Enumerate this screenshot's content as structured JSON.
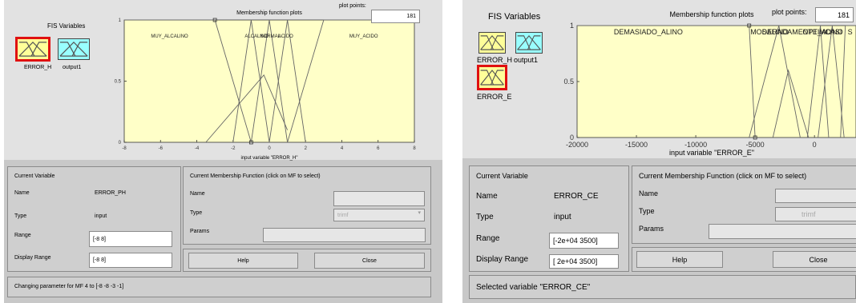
{
  "left": {
    "fis_title": "FIS Variables",
    "plot_title": "Membership function plots",
    "plot_points_label": "plot points:",
    "plot_points_value": "181",
    "inputs": [
      {
        "label": "ERROR_H",
        "selected": true
      }
    ],
    "outputs": [
      {
        "label": "output1",
        "selected": false
      }
    ],
    "mf_labels": [
      "MUY_ALCALINO",
      "ALCALINO",
      "NORMAL",
      "ACIDO",
      "MUY_ACIDO"
    ],
    "y_ticks": [
      "1",
      "0.5",
      "0"
    ],
    "x_ticks": [
      "-8",
      "-6",
      "-4",
      "-2",
      "0",
      "2",
      "4",
      "6",
      "8"
    ],
    "x_axis_label": "input variable \"ERROR_H\"",
    "current_variable": {
      "title": "Current Variable",
      "name_label": "Name",
      "name_value": "ERROR_PH",
      "type_label": "Type",
      "type_value": "input",
      "range_label": "Range",
      "range_value": "[-8 8]",
      "display_range_label": "Display Range",
      "display_range_value": "[-8 8]"
    },
    "current_mf": {
      "title": "Current Membership Function (click on MF to select)",
      "name_label": "Name",
      "name_value": "",
      "type_label": "Type",
      "type_value": "trimf",
      "params_label": "Params",
      "params_value": ""
    },
    "help_label": "Help",
    "close_label": "Close",
    "status": "Changing parameter for MF 4 to [-8 -8 -3 -1]"
  },
  "right": {
    "fis_title": "FIS Variables",
    "plot_title": "Membership function plots",
    "plot_points_label": "plot points:",
    "plot_points_value": "181",
    "inputs": [
      {
        "label": "ERROR_H",
        "selected": false
      },
      {
        "label": "ERROR_E",
        "selected": true
      }
    ],
    "outputs": [
      {
        "label": "output1",
        "selected": false
      }
    ],
    "mf_labels": [
      "DEMASIADO_ALINO",
      "SALINO",
      "MODERADAMENTE_ALINO",
      "OPTIMO",
      "CASI",
      "S"
    ],
    "y_ticks": [
      "1",
      "0.5",
      "0"
    ],
    "x_ticks": [
      "-20000",
      "-15000",
      "-10000",
      "-5000",
      "0"
    ],
    "x_axis_label": "input variable \"ERROR_E\"",
    "current_variable": {
      "title": "Current Variable",
      "name_label": "Name",
      "name_value": "ERROR_CE",
      "type_label": "Type",
      "type_value": "input",
      "range_label": "Range",
      "range_value": "[-2e+04 3500]",
      "display_range_label": "Display Range",
      "display_range_value": "[ 2e+04 3500]"
    },
    "current_mf": {
      "title": "Current Membership Function (click on MF to select)",
      "name_label": "Name",
      "name_value": "",
      "type_label": "Type",
      "type_value": "trimf",
      "params_label": "Params",
      "params_value": ""
    },
    "help_label": "Help",
    "close_label": "Close",
    "status": "Selected variable \"ERROR_CE\""
  },
  "colors": {
    "plot_bg": "#ffffc8",
    "selected_border": "#e01010",
    "input_icon": "#ffff99",
    "output_icon": "#99ffff",
    "window_bg": "#c8c8c8"
  },
  "icons": {
    "input_variable": "triangle-mf-icon",
    "output_variable": "triangle-mf-icon"
  }
}
